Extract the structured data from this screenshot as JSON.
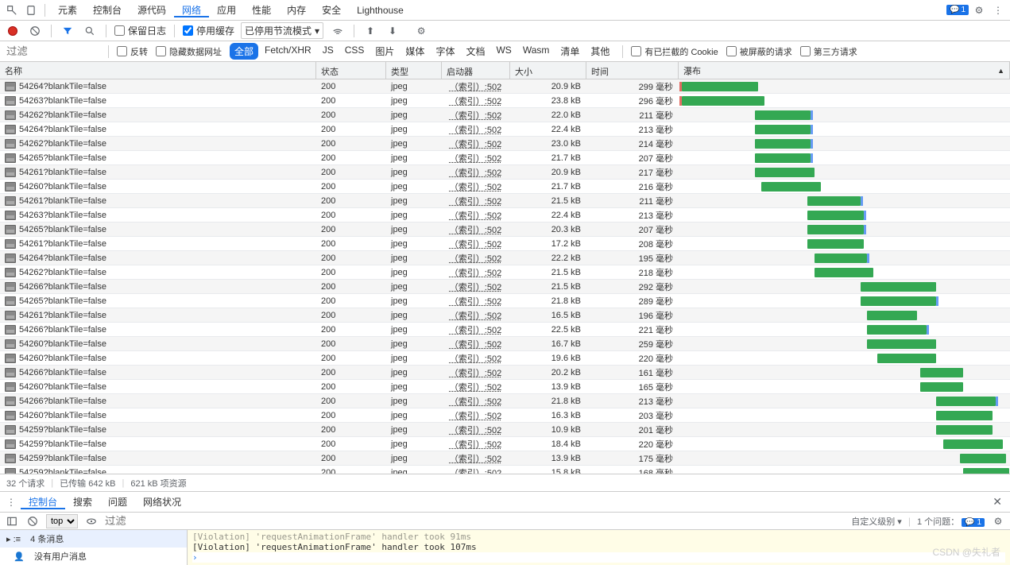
{
  "tabs": {
    "items": [
      "元素",
      "控制台",
      "源代码",
      "网络",
      "应用",
      "性能",
      "内存",
      "安全",
      "Lighthouse"
    ],
    "active": 3,
    "issues_count": "1"
  },
  "toolbar": {
    "preserve_log": "保留日志",
    "disable_cache": "停用缓存",
    "throttle": "已停用节流模式"
  },
  "filterbar": {
    "filter_placeholder": "过滤",
    "invert": "反转",
    "hide_data": "隐藏数据网址",
    "types": [
      "全部",
      "Fetch/XHR",
      "JS",
      "CSS",
      "图片",
      "媒体",
      "字体",
      "文档",
      "WS",
      "Wasm",
      "清单",
      "其他"
    ],
    "active_type": 0,
    "blocked_cookies": "有已拦截的 Cookie",
    "blocked_req": "被屏蔽的请求",
    "third_party": "第三方请求"
  },
  "columns": {
    "name": "名称",
    "status": "状态",
    "type": "类型",
    "initiator": "启动器",
    "size": "大小",
    "time": "时间",
    "waterfall": "瀑布"
  },
  "initiator_text": "（索引）:502",
  "rows": [
    {
      "name": "54264?blankTile=false",
      "status": "200",
      "type": "jpeg",
      "size": "20.9 kB",
      "time": "299 毫秒",
      "wf_start": 1,
      "wf_len": 23,
      "wait": true
    },
    {
      "name": "54263?blankTile=false",
      "status": "200",
      "type": "jpeg",
      "size": "23.8 kB",
      "time": "296 毫秒",
      "wf_start": 1,
      "wf_len": 25,
      "wait": true
    },
    {
      "name": "54262?blankTile=false",
      "status": "200",
      "type": "jpeg",
      "size": "22.0 kB",
      "time": "211 毫秒",
      "wf_start": 23,
      "wf_len": 17,
      "xtra": true
    },
    {
      "name": "54264?blankTile=false",
      "status": "200",
      "type": "jpeg",
      "size": "22.4 kB",
      "time": "213 毫秒",
      "wf_start": 23,
      "wf_len": 17,
      "xtra": true
    },
    {
      "name": "54262?blankTile=false",
      "status": "200",
      "type": "jpeg",
      "size": "23.0 kB",
      "time": "214 毫秒",
      "wf_start": 23,
      "wf_len": 17,
      "xtra": true
    },
    {
      "name": "54265?blankTile=false",
      "status": "200",
      "type": "jpeg",
      "size": "21.7 kB",
      "time": "207 毫秒",
      "wf_start": 23,
      "wf_len": 17,
      "xtra": true
    },
    {
      "name": "54261?blankTile=false",
      "status": "200",
      "type": "jpeg",
      "size": "20.9 kB",
      "time": "217 毫秒",
      "wf_start": 23,
      "wf_len": 18
    },
    {
      "name": "54260?blankTile=false",
      "status": "200",
      "type": "jpeg",
      "size": "21.7 kB",
      "time": "216 毫秒",
      "wf_start": 25,
      "wf_len": 18
    },
    {
      "name": "54261?blankTile=false",
      "status": "200",
      "type": "jpeg",
      "size": "21.5 kB",
      "time": "211 毫秒",
      "wf_start": 39,
      "wf_len": 16,
      "xtra": true
    },
    {
      "name": "54263?blankTile=false",
      "status": "200",
      "type": "jpeg",
      "size": "22.4 kB",
      "time": "213 毫秒",
      "wf_start": 39,
      "wf_len": 17,
      "xtra": true
    },
    {
      "name": "54265?blankTile=false",
      "status": "200",
      "type": "jpeg",
      "size": "20.3 kB",
      "time": "207 毫秒",
      "wf_start": 39,
      "wf_len": 17,
      "xtra": true
    },
    {
      "name": "54261?blankTile=false",
      "status": "200",
      "type": "jpeg",
      "size": "17.2 kB",
      "time": "208 毫秒",
      "wf_start": 39,
      "wf_len": 17
    },
    {
      "name": "54264?blankTile=false",
      "status": "200",
      "type": "jpeg",
      "size": "22.2 kB",
      "time": "195 毫秒",
      "wf_start": 41,
      "wf_len": 16,
      "xtra": true
    },
    {
      "name": "54262?blankTile=false",
      "status": "200",
      "type": "jpeg",
      "size": "21.5 kB",
      "time": "218 毫秒",
      "wf_start": 41,
      "wf_len": 18
    },
    {
      "name": "54266?blankTile=false",
      "status": "200",
      "type": "jpeg",
      "size": "21.5 kB",
      "time": "292 毫秒",
      "wf_start": 55,
      "wf_len": 23
    },
    {
      "name": "54265?blankTile=false",
      "status": "200",
      "type": "jpeg",
      "size": "21.8 kB",
      "time": "289 毫秒",
      "wf_start": 55,
      "wf_len": 23,
      "xtra": true
    },
    {
      "name": "54261?blankTile=false",
      "status": "200",
      "type": "jpeg",
      "size": "16.5 kB",
      "time": "196 毫秒",
      "wf_start": 57,
      "wf_len": 15
    },
    {
      "name": "54266?blankTile=false",
      "status": "200",
      "type": "jpeg",
      "size": "22.5 kB",
      "time": "221 毫秒",
      "wf_start": 57,
      "wf_len": 18,
      "xtra": true
    },
    {
      "name": "54260?blankTile=false",
      "status": "200",
      "type": "jpeg",
      "size": "16.7 kB",
      "time": "259 毫秒",
      "wf_start": 57,
      "wf_len": 21
    },
    {
      "name": "54260?blankTile=false",
      "status": "200",
      "type": "jpeg",
      "size": "19.6 kB",
      "time": "220 毫秒",
      "wf_start": 60,
      "wf_len": 18
    },
    {
      "name": "54266?blankTile=false",
      "status": "200",
      "type": "jpeg",
      "size": "20.2 kB",
      "time": "161 毫秒",
      "wf_start": 73,
      "wf_len": 13
    },
    {
      "name": "54260?blankTile=false",
      "status": "200",
      "type": "jpeg",
      "size": "13.9 kB",
      "time": "165 毫秒",
      "wf_start": 73,
      "wf_len": 13
    },
    {
      "name": "54266?blankTile=false",
      "status": "200",
      "type": "jpeg",
      "size": "21.8 kB",
      "time": "213 毫秒",
      "wf_start": 78,
      "wf_len": 18,
      "xtra": true
    },
    {
      "name": "54260?blankTile=false",
      "status": "200",
      "type": "jpeg",
      "size": "16.3 kB",
      "time": "203 毫秒",
      "wf_start": 78,
      "wf_len": 17
    },
    {
      "name": "54259?blankTile=false",
      "status": "200",
      "type": "jpeg",
      "size": "10.9 kB",
      "time": "201 毫秒",
      "wf_start": 78,
      "wf_len": 17
    },
    {
      "name": "54259?blankTile=false",
      "status": "200",
      "type": "jpeg",
      "size": "18.4 kB",
      "time": "220 毫秒",
      "wf_start": 80,
      "wf_len": 18
    },
    {
      "name": "54259?blankTile=false",
      "status": "200",
      "type": "jpeg",
      "size": "13.9 kB",
      "time": "175 毫秒",
      "wf_start": 85,
      "wf_len": 14
    },
    {
      "name": "54259?blankTile=false",
      "status": "200",
      "type": "jpeg",
      "size": "15.8 kB",
      "time": "168 毫秒",
      "wf_start": 86,
      "wf_len": 14
    }
  ],
  "status": {
    "requests": "32 个请求",
    "transferred": "已传输 642 kB",
    "resources": "621 kB 项资源"
  },
  "drawer": {
    "tabs": [
      "控制台",
      "搜索",
      "问题",
      "网络状况"
    ],
    "active": 0
  },
  "console": {
    "context": "top",
    "filter_placeholder": "过滤",
    "level": "自定义级别",
    "issues_label": "1 个问题：",
    "issues_count": "1",
    "sidebar": {
      "messages": "4 条消息",
      "no_user": "没有用户消息"
    },
    "lines": [
      "[Violation] 'requestAnimationFrame' handler took 91ms",
      "[Violation] 'requestAnimationFrame' handler took 107ms"
    ]
  },
  "watermark": "CSDN @失礼者"
}
